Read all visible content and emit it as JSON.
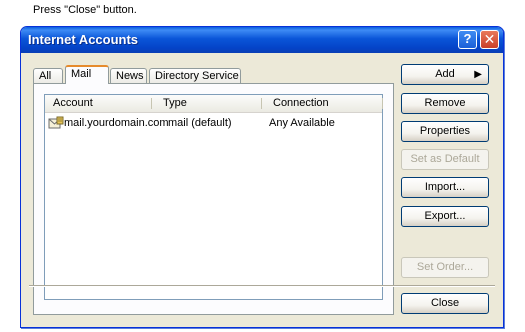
{
  "instruction": "Press \"Close\" button.",
  "window": {
    "title": "Internet Accounts",
    "help_glyph": "?",
    "close_glyph": "✕"
  },
  "tabs": [
    "All",
    "Mail",
    "News",
    "Directory Service"
  ],
  "active_tab": "Mail",
  "list": {
    "columns": [
      "Account",
      "Type",
      "Connection"
    ],
    "rows": [
      {
        "account": "mail.yourdomain.com",
        "type": "mail (default)",
        "connection": "Any Available"
      }
    ]
  },
  "buttons": {
    "add": "Add",
    "remove": "Remove",
    "properties": "Properties",
    "set_default": "Set as Default",
    "import": "Import...",
    "export": "Export...",
    "set_order": "Set Order...",
    "close": "Close"
  },
  "icons": {
    "add_chevron": "▶",
    "account_icon": "mail-account-icon"
  }
}
